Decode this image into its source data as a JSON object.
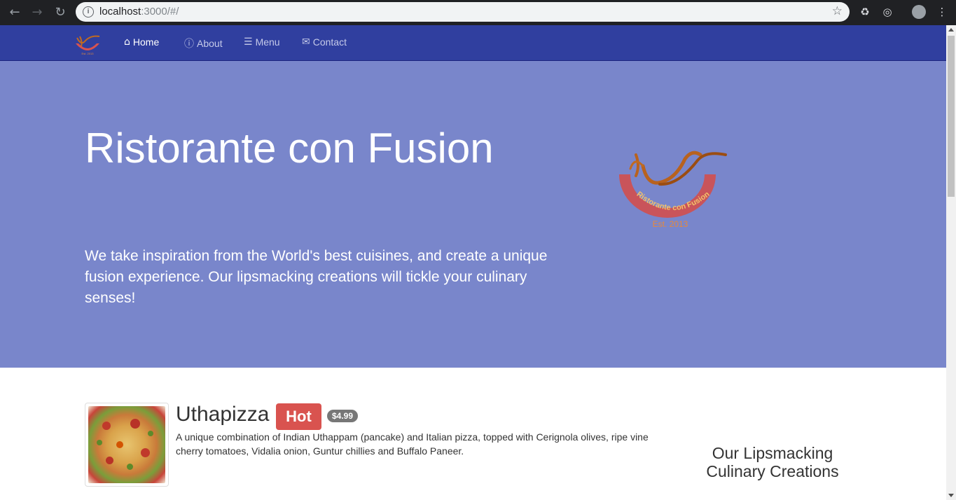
{
  "browser": {
    "url_host": "localhost",
    "url_path": ":3000/#/"
  },
  "navbar": {
    "items": [
      {
        "label": "Home",
        "icon": "home-icon"
      },
      {
        "label": "About",
        "icon": "info-icon"
      },
      {
        "label": "Menu",
        "icon": "list-icon"
      },
      {
        "label": "Contact",
        "icon": "envelope-icon"
      }
    ],
    "active_color": "#ffffff",
    "bg_color": "#303f9f"
  },
  "jumbotron": {
    "title": "Ristorante con Fusion",
    "text": "We take inspiration from the World's best cuisines, and create a unique fusion experience. Our lipsmacking creations will tickle your culinary senses!",
    "logo_text": "Ristorante con Fusion",
    "logo_est": "Est. 2013",
    "bg_color": "#7986cb"
  },
  "dish": {
    "name": "Uthapizza",
    "label": "Hot",
    "price": "$4.99",
    "description": "A unique combination of Indian Uthappam (pancake) and Italian pizza, topped with Cerignola olives, ripe vine cherry tomatoes, Vidalia onion, Guntur chillies and Buffalo Paneer."
  },
  "sidebar": {
    "title": "Our Lipsmacking Culinary Creations"
  }
}
